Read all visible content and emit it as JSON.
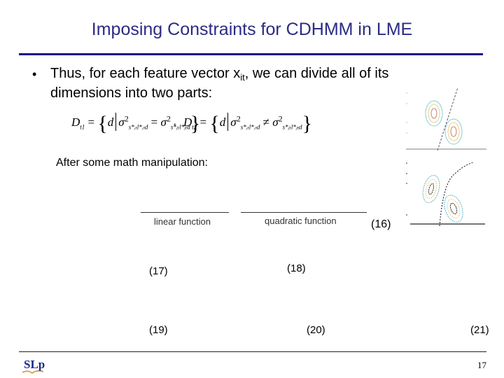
{
  "slide": {
    "title": "Imposing Constraints for CDHMM in LME",
    "title_color": "#2b2b86",
    "rule_color": "#10108a",
    "bullet": {
      "symbol": "•",
      "text_before_sub": "Thus, for each feature vector x",
      "subscript": "it",
      "text_after_sub": ", we can divide all of its",
      "line2": "dimensions into two parts:"
    },
    "set_definitions": {
      "d1": {
        "lhs": "D",
        "lhs_sub": "t1",
        "equals": "=",
        "open": "{",
        "var": "d",
        "sigma": "σ",
        "power": "2",
        "left_sub": "s*ᵢₜl*ᵢₜd",
        "relation": "=",
        "right_sub": "s*ⱼₜl*ⱼₜd",
        "close": "}"
      },
      "separator": ",",
      "d2": {
        "lhs": "D",
        "lhs_sub": "t2",
        "equals": "=",
        "open": "{",
        "var": "d",
        "sigma": "σ",
        "power": "2",
        "left_sub": "s*ᵢₜl*ᵢₜd",
        "relation": "≠",
        "right_sub": "s*ⱼₜl*ⱼₜd",
        "close": "}"
      }
    },
    "after_text": "After some math manipulation:",
    "underbrace_labels": {
      "linear": "linear function",
      "quadratic": "quadratic function"
    },
    "equation_numbers": {
      "eq16": "(16)",
      "eq17": "(17)",
      "eq18": "(18)",
      "eq19": "(19)",
      "eq20": "(20)",
      "eq21": "(21)"
    },
    "figures": {
      "fig1": {
        "description": "two gaussian contour clusters separated by a linear boundary"
      },
      "fig2": {
        "description": "two gaussian contour clusters separated by a quadratic boundary"
      }
    },
    "footer": {
      "logo_text": "SLP",
      "page_number": "17"
    }
  }
}
